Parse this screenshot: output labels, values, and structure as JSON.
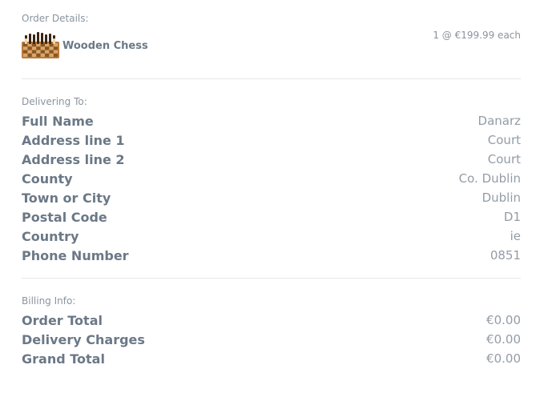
{
  "order": {
    "label": "Order Details:",
    "product_name": "Wooden Chess",
    "quantity_text": "1 @ €199.99 each"
  },
  "delivery": {
    "label": "Delivering To:",
    "rows": [
      {
        "key": "Full Name",
        "value": "Danarz"
      },
      {
        "key": "Address line 1",
        "value": "Court"
      },
      {
        "key": "Address line 2",
        "value": "Court"
      },
      {
        "key": "County",
        "value": "Co. Dublin"
      },
      {
        "key": "Town or City",
        "value": "Dublin"
      },
      {
        "key": "Postal Code",
        "value": "D1"
      },
      {
        "key": "Country",
        "value": "ie"
      },
      {
        "key": "Phone Number",
        "value": "0851"
      }
    ]
  },
  "billing": {
    "label": "Billing Info:",
    "rows": [
      {
        "key": "Order Total",
        "value": "€0.00"
      },
      {
        "key": "Delivery Charges",
        "value": "€0.00"
      },
      {
        "key": "Grand Total",
        "value": "€0.00"
      }
    ]
  }
}
